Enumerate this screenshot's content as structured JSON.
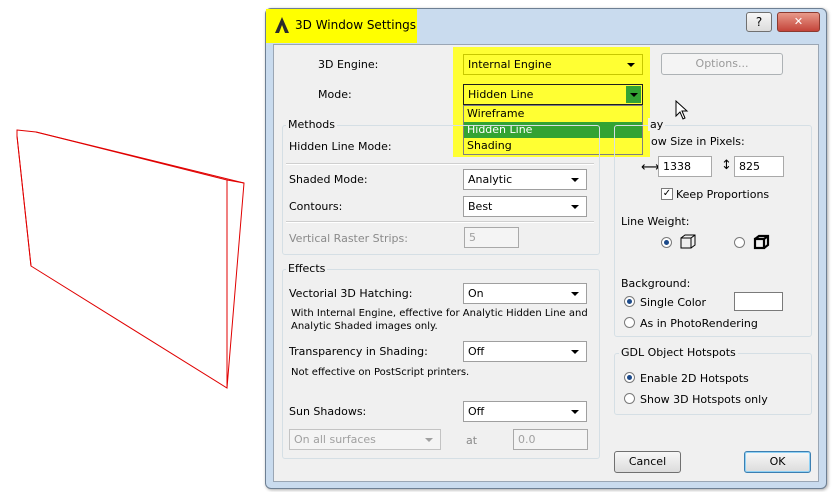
{
  "dialog": {
    "title": "3D Window Settings",
    "help_label": "?",
    "close_label": "✕"
  },
  "engine": {
    "label": "3D Engine:",
    "value": "Internal Engine",
    "options_label": "Options..."
  },
  "mode": {
    "label": "Mode:",
    "value": "Hidden Line",
    "options": [
      "Wireframe",
      "Hidden Line",
      "Shading"
    ],
    "selected_index": 1
  },
  "methods": {
    "group_label": "Methods",
    "hidden_line_label": "Hidden Line Mode:",
    "shaded_label": "Shaded Mode:",
    "shaded_value": "Analytic",
    "contours_label": "Contours:",
    "contours_value": "Best",
    "raster_label": "Vertical Raster Strips:",
    "raster_value": "5"
  },
  "effects": {
    "group_label": "Effects",
    "hatching_label": "Vectorial 3D Hatching:",
    "hatching_value": "On",
    "hatching_note_1": "With Internal Engine, effective for Analytic Hidden Line and",
    "hatching_note_2": "Analytic Shaded images only.",
    "transparency_label": "Transparency in Shading:",
    "transparency_value": "Off",
    "transparency_note": "Not effective on PostScript printers.",
    "sun_label": "Sun Shadows:",
    "sun_value": "Off",
    "surfaces_value": "On all surfaces",
    "at_label": "at",
    "at_value": "0.0"
  },
  "display": {
    "group_label_fragment": "ay",
    "window_size_label": "ow Size in Pixels:",
    "width_value": "1338",
    "height_value": "825",
    "keep_proportions_label": "Keep Proportions",
    "line_weight_label": "Line Weight:",
    "background_label": "Background:",
    "single_color_label": "Single Color",
    "photorendering_label": "As in PhotoRendering"
  },
  "gdl": {
    "group_label": "GDL Object Hotspots",
    "enable_2d_label": "Enable 2D Hotspots",
    "show_3d_label": "Show 3D Hotspots only"
  },
  "buttons": {
    "cancel": "Cancel",
    "ok": "OK"
  },
  "colors": {
    "highlight": "#ffff00",
    "selected_item": "#33a333",
    "preview_stroke": "#e00000",
    "dialog_frame": "#c9dbee"
  },
  "icons": {
    "app": "archicad-logo-icon",
    "width_arrow": "horizontal-arrows-icon",
    "height_arrow": "vertical-arrows-icon",
    "line_weight_1": "thin-cube-icon",
    "line_weight_2": "bold-cube-icon"
  }
}
